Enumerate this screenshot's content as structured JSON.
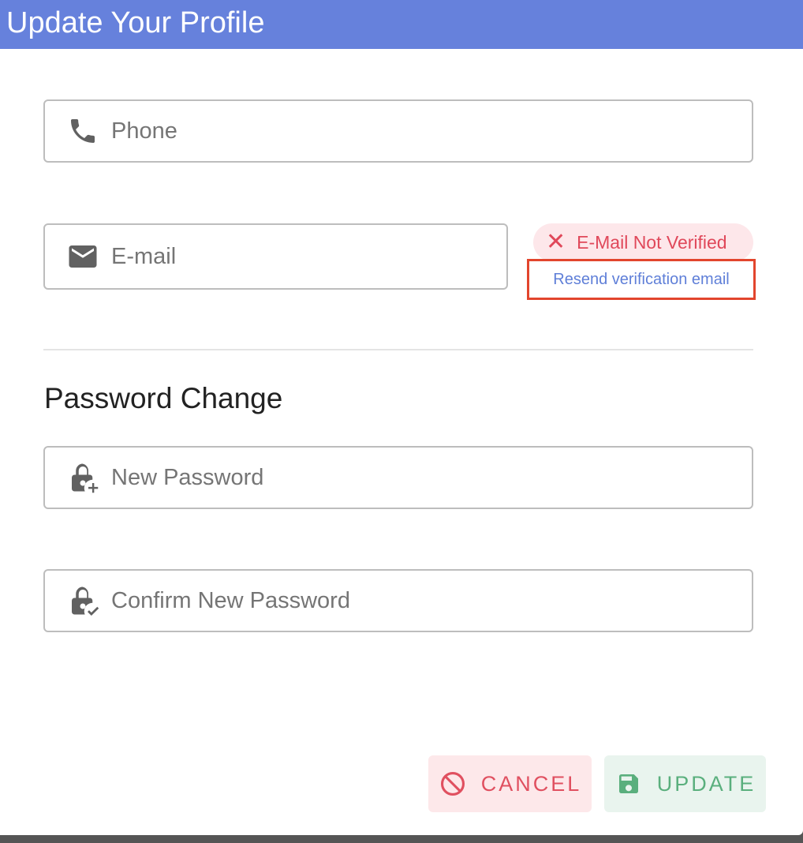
{
  "header": {
    "title": "Update Your Profile"
  },
  "fields": {
    "phone": {
      "placeholder": "Phone",
      "icon": "phone-icon"
    },
    "email": {
      "placeholder": "E-mail",
      "icon": "email-icon"
    },
    "new_password": {
      "placeholder": "New Password",
      "icon": "lock-plus-icon"
    },
    "confirm_password": {
      "placeholder": "Confirm New Password",
      "icon": "lock-check-icon"
    }
  },
  "email_status": {
    "badge_label": "E-Mail Not Verified",
    "badge_icon": "close-icon",
    "resend_link": "Resend verification email"
  },
  "password_section": {
    "title": "Password Change"
  },
  "actions": {
    "cancel_label": "CANCEL",
    "update_label": "UPDATE"
  },
  "colors": {
    "header": "#6681dc",
    "error": "#e0485a",
    "link": "#5f7fd8",
    "success": "#5aaf7d",
    "highlight": "#e2452d"
  }
}
